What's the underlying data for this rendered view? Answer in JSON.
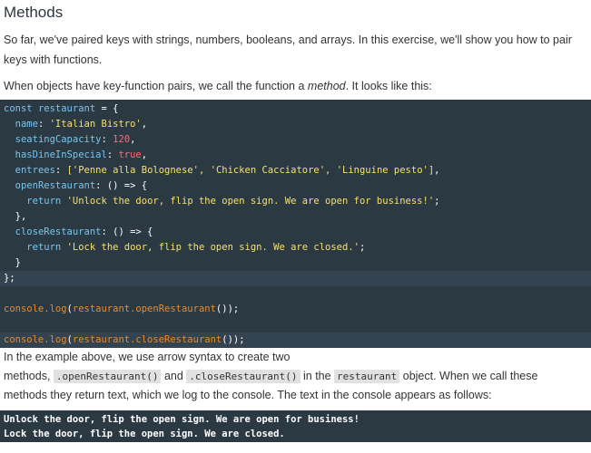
{
  "heading": "Methods",
  "intro": "So far, we've paired keys with strings, numbers, booleans, and arrays. In this exercise, we'll show you how to pair keys with functions.",
  "lead": {
    "before": "When objects have key-function pairs, we call the function a ",
    "em": "method",
    "after": ". It looks like this:"
  },
  "code": {
    "const_kw": "const",
    "obj_name": "restaurant",
    "eq_brace": " = {",
    "name_key": "name",
    "name_val": "'Italian Bistro'",
    "seating_key": "seatingCapacity",
    "seating_val": "120",
    "dine_key": "hasDineInSpecial",
    "dine_val": "true",
    "entrees_key": "entrees",
    "entrees_val": "['Penne alla Bolognese', 'Chicken Cacciatore', 'Linguine pesto']",
    "open_key": "openRestaurant",
    "arrow": ": () => {",
    "return_kw": "return",
    "open_msg": "'Unlock the door, flip the open sign. We are open for business!'",
    "close_fn_brace": "},",
    "close_key": "closeRestaurant",
    "close_msg": "'Lock the door, flip the open sign. We are closed.'",
    "close_inner": "}",
    "close_obj": "};",
    "console_call": "console.log",
    "open_call": "restaurant.openRestaurant",
    "close_call": "restaurant.closeRestaurant",
    "call_suffix": "());"
  },
  "explain": {
    "line1": "In the example above, we use arrow syntax to create two",
    "methods_word": "methods, ",
    "code1": ".openRestaurant()",
    "and": " and ",
    "code2": ".closeRestaurant()",
    "in_the": " in the ",
    "code3": "restaurant",
    "rest": " object. When we call these",
    "line3": "methods they return text, which we log to the console. The text in the console appears as follows:"
  },
  "console_output": [
    "Unlock the door, flip the open sign. We are open for business!",
    "Lock the door, flip the open sign. We are closed."
  ],
  "colors": {
    "code_bg": "#2b3943",
    "keyword": "#78c6f0",
    "string": "#f7e06c",
    "number": "#ff6b73",
    "function": "#e88c2c"
  }
}
